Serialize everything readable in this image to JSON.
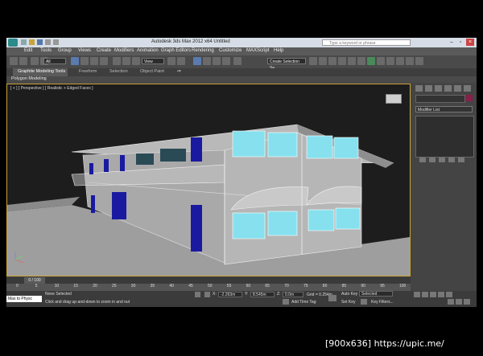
{
  "window": {
    "title": "Autodesk 3ds Max 2012 x64    Untitled"
  },
  "help_search": {
    "placeholder": "Type a keyword or phrase"
  },
  "menu": [
    "Edit",
    "Tools",
    "Group",
    "Views",
    "Create",
    "Modifiers",
    "Animation",
    "Graph Editors",
    "Rendering",
    "Customize",
    "MAXScript",
    "Help"
  ],
  "toolbar": {
    "selection_filter": "All",
    "ref_coord": "View",
    "named_selection": "Create Selection Se"
  },
  "ribbon": {
    "tabs": [
      "Graphite Modeling Tools",
      "Freeform",
      "Selection",
      "Object Paint"
    ],
    "subtab": "Polygon Modeling"
  },
  "viewport": {
    "label": "[ + ] [ Perspective ] [ Realistic + Edged Faces ]"
  },
  "command_panel": {
    "modifier_list": "Modifier List"
  },
  "timeline": {
    "frame_counter": "0 / 100",
    "ticks": [
      "0",
      "5",
      "10",
      "15",
      "20",
      "25",
      "30",
      "35",
      "40",
      "45",
      "50",
      "55",
      "60",
      "65",
      "70",
      "75",
      "80",
      "85",
      "90",
      "95",
      "100"
    ]
  },
  "status": {
    "selection": "None Selected",
    "prompt": "Click and drag up-and-down to zoom in and out",
    "x": "-2.263m",
    "y": "8.545m",
    "z": "0.0m",
    "grid": "Grid = 0.254m",
    "auto_key": "Auto Key",
    "selected": "Selected",
    "set_key": "Set Key",
    "key_filters": "Key Filters...",
    "add_time_tag": "Add Time Tag",
    "maxscript": "Max to Physc"
  },
  "credit": "[900x636] https://upic.me/"
}
